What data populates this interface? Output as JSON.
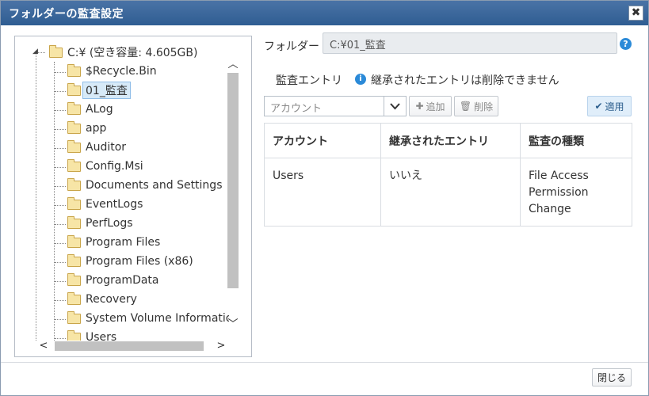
{
  "window": {
    "title": "フォルダーの監査設定",
    "close_glyph": "✖"
  },
  "tree": {
    "root": {
      "label": "C:¥ (空き容量: 4.605GB)",
      "expanded": true
    },
    "children": [
      {
        "label": "$Recycle.Bin"
      },
      {
        "label": "01_監査",
        "selected": true
      },
      {
        "label": "ALog"
      },
      {
        "label": "app"
      },
      {
        "label": "Auditor"
      },
      {
        "label": "Config.Msi"
      },
      {
        "label": "Documents and Settings"
      },
      {
        "label": "EventLogs"
      },
      {
        "label": "PerfLogs"
      },
      {
        "label": "Program Files"
      },
      {
        "label": "Program Files (x86)"
      },
      {
        "label": "ProgramData"
      },
      {
        "label": "Recovery"
      },
      {
        "label": "System Volume Informatio"
      },
      {
        "label": "Users"
      }
    ]
  },
  "form": {
    "folder_label": "フォルダー",
    "folder_value": "C:¥01_監査",
    "help_glyph": "?",
    "audit_entry_label": "監査エントリ",
    "info_glyph": "i",
    "inherited_note": "継承されたエントリは削除できません",
    "account_placeholder": "アカウント",
    "add_label": "追加",
    "delete_label": "削除",
    "apply_label": "適用",
    "close_label": "閉じる"
  },
  "table": {
    "headers": [
      "アカウント",
      "継承されたエントリ",
      "監査の種類"
    ],
    "rows": [
      {
        "account": "Users",
        "inherited": "いいえ",
        "audit_types": [
          "File Access",
          "Permission",
          "Change"
        ]
      }
    ]
  },
  "colors": {
    "titlebar": "#2f5d92",
    "accent": "#2b8ad8",
    "folder_fill": "#f7e5a6",
    "selected_bg": "#d7eaf8"
  }
}
